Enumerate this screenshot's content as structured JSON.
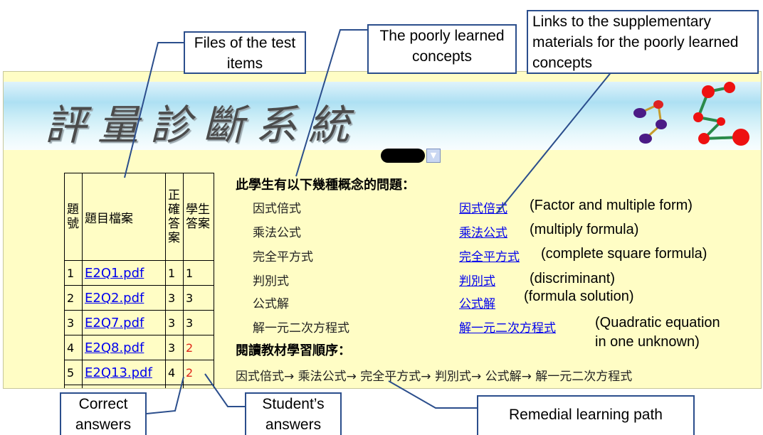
{
  "banner": {
    "title": "評量診斷系統"
  },
  "table": {
    "headers": [
      "題號",
      "題目檔案",
      "正確答案",
      "學生答案"
    ],
    "rows": [
      {
        "no": "1",
        "file": "E2Q1.pdf",
        "correct": "1",
        "student": "1"
      },
      {
        "no": "2",
        "file": "E2Q2.pdf",
        "correct": "3",
        "student": "3"
      },
      {
        "no": "3",
        "file": "E2Q7.pdf",
        "correct": "3",
        "student": "3"
      },
      {
        "no": "4",
        "file": "E2Q8.pdf",
        "correct": "3",
        "student": "2"
      },
      {
        "no": "5",
        "file": "E2Q13.pdf",
        "correct": "4",
        "student": "2"
      }
    ]
  },
  "diagnosis": {
    "heading": "此學生有以下幾種概念的問題：",
    "concepts": [
      "因式倍式",
      "乘法公式",
      "完全平方式",
      "判別式",
      "公式解",
      "解一元二次方程式"
    ],
    "links": [
      "因式倍式",
      "乘法公式",
      "完全平方式",
      "判別式",
      "公式解",
      "解一元二次方程式"
    ],
    "translations": [
      "(Factor and multiple form)",
      "(multiply formula)",
      "(complete square formula)",
      "(discriminant)",
      "(formula solution)",
      "(Quadratic equation",
      "in one unknown)"
    ],
    "order_heading": "閱讀教材學習順序：",
    "order_text": "因式倍式→ 乘法公式→ 完全平方式→ 判別式→ 公式解→ 解一元二次方程式"
  },
  "callouts": {
    "files": "Files of the test items",
    "concepts": "The poorly learned concepts",
    "links": "Links to the supplementary materials for the poorly learned concepts",
    "correct": "Correct answers",
    "student": "Student’s answers",
    "path": "Remedial learning path"
  },
  "colors": {
    "link": "#0000ee",
    "wrong_answer": "#e0271b",
    "page_bg": "#fffdc5",
    "callout_border": "#2b4e8c"
  }
}
